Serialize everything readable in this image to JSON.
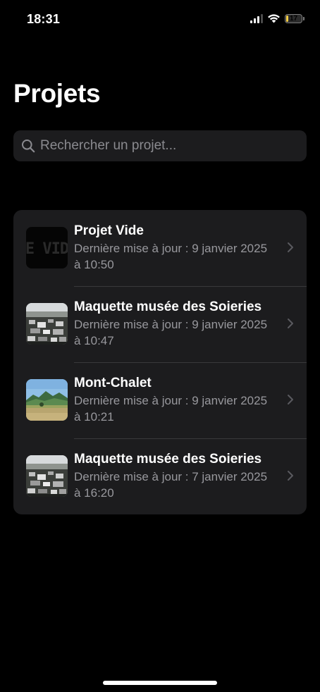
{
  "status_bar": {
    "time": "18:31",
    "battery_level": "17",
    "battery_fraction": 0.17,
    "signal_bars": 3,
    "wifi": true
  },
  "header": {
    "title": "Projets"
  },
  "search": {
    "placeholder": "Rechercher un projet...",
    "value": ""
  },
  "projects": [
    {
      "title": "Projet Vide",
      "subtitle": "Dernière mise à jour : 9 janvier 2025 à 10:50",
      "thumbnail": "empty-project-thumbnail",
      "thumbnail_text": "E VID"
    },
    {
      "title": "Maquette musée des Soieries",
      "subtitle": "Dernière mise à jour : 9 janvier 2025 à 10:47",
      "thumbnail": "aerial-city-thumbnail"
    },
    {
      "title": "Mont-Chalet",
      "subtitle": "Dernière mise à jour : 9 janvier 2025 à 10:21",
      "thumbnail": "mountain-landscape-thumbnail"
    },
    {
      "title": "Maquette musée des Soieries",
      "subtitle": "Dernière mise à jour : 7 janvier 2025 à 16:20",
      "thumbnail": "aerial-city-thumbnail"
    }
  ],
  "colors": {
    "background": "#000000",
    "card": "#1c1c1e",
    "secondary_text": "#98989d",
    "battery": "#f7ce46"
  }
}
